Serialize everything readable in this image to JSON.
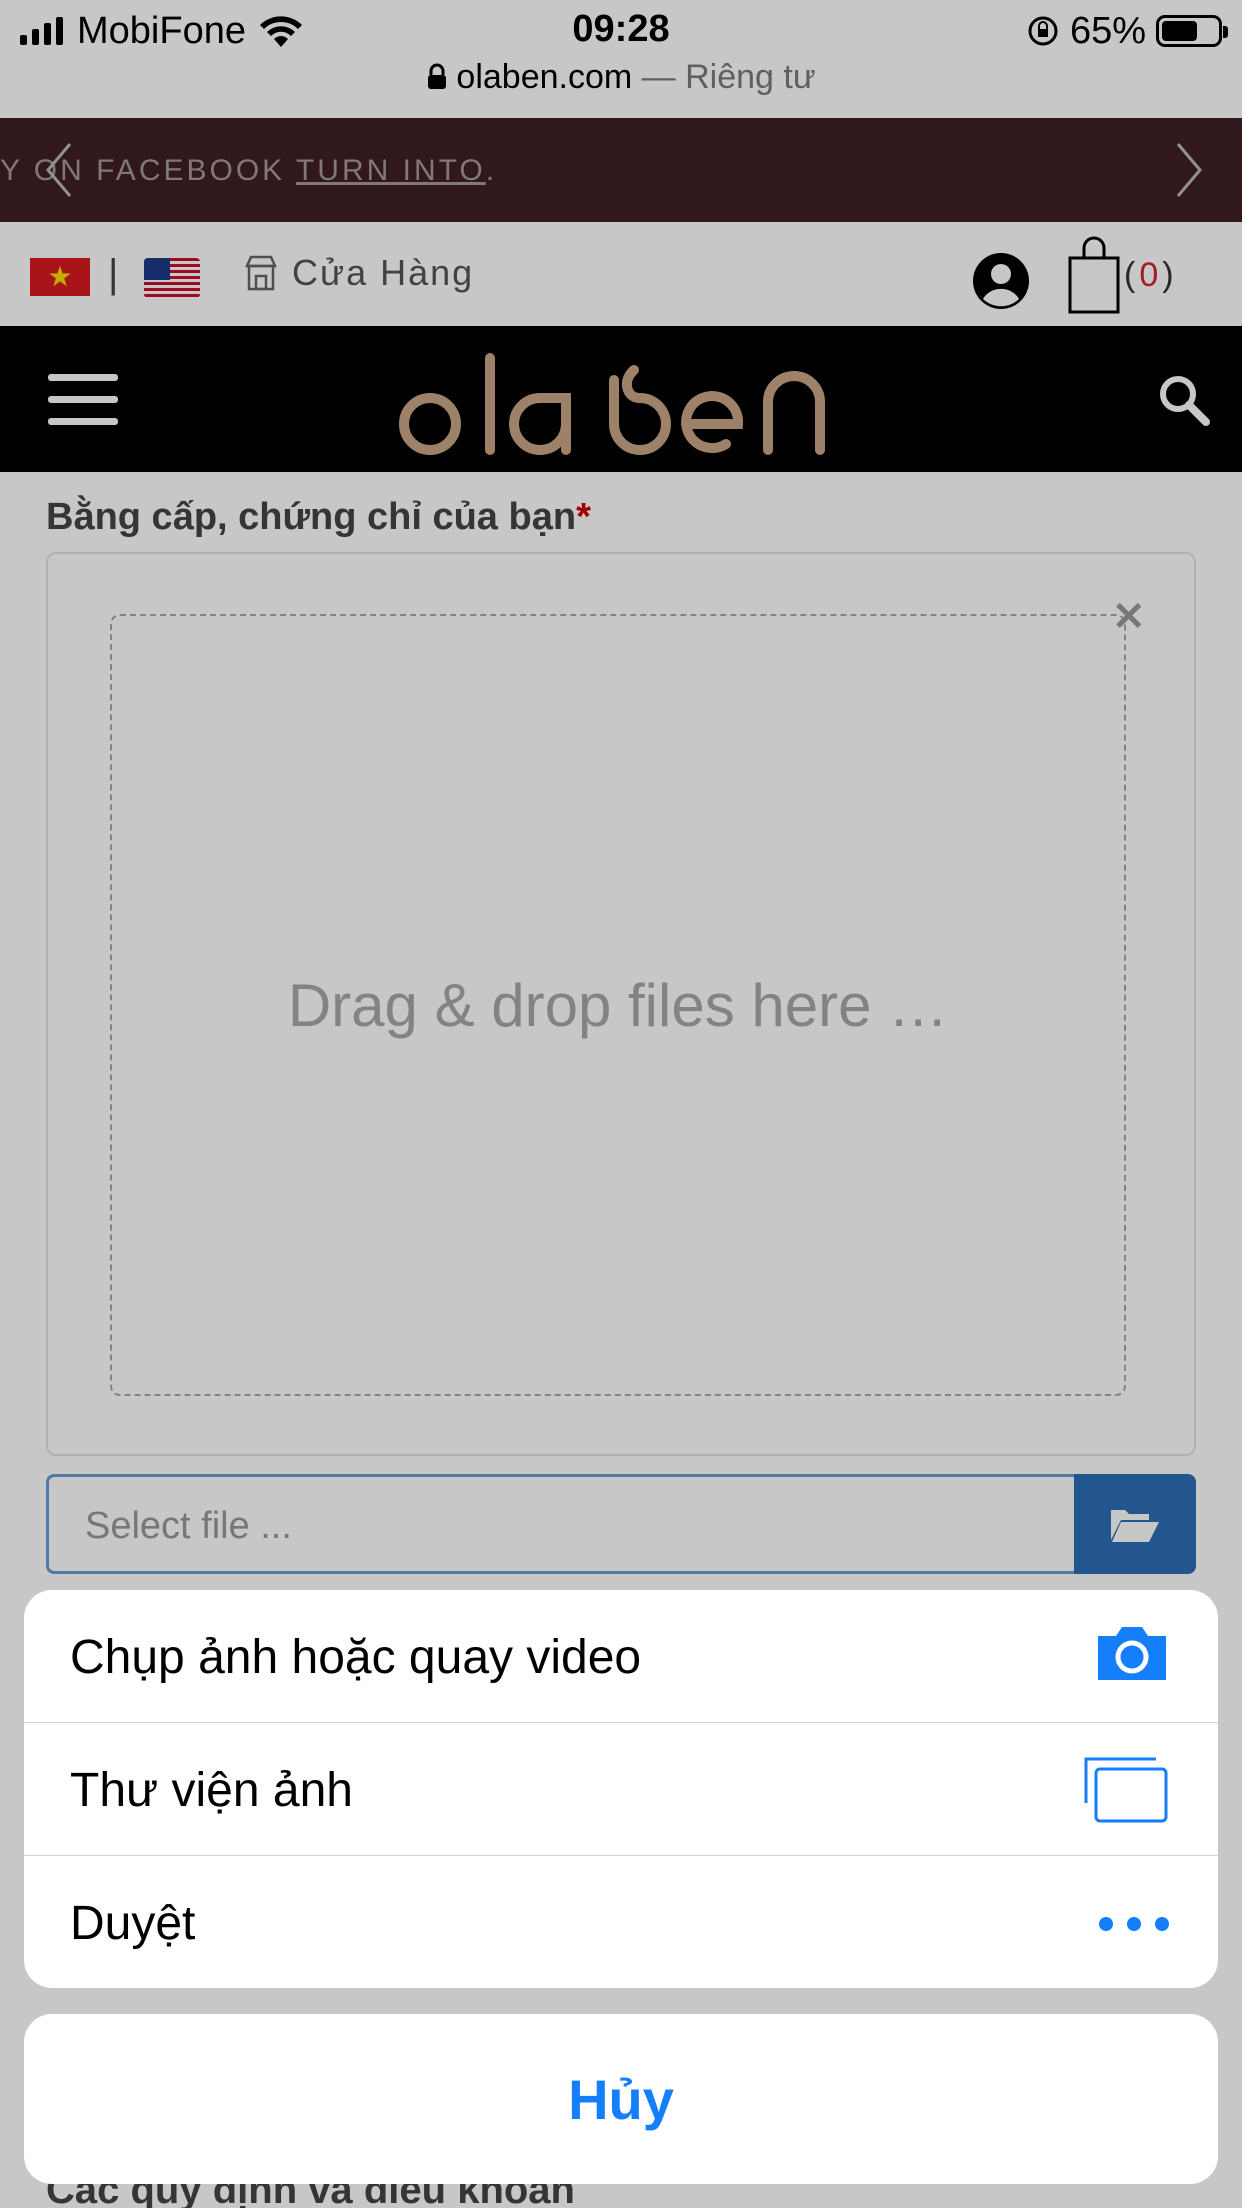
{
  "status_bar": {
    "carrier": "MobiFone",
    "time": "09:28",
    "battery": "65%",
    "battery_level": 0.65
  },
  "browser": {
    "domain": "olaben.com",
    "private_label": "— Riêng tư"
  },
  "promo": {
    "text_before": "Y ON FACEBOOK ",
    "link": "TURN INTO",
    "text_after": "."
  },
  "topbar": {
    "store_label": "Cửa Hàng",
    "cart_open": "(",
    "cart_count": "0",
    "cart_close": ")"
  },
  "header": {
    "logo_text": "olaben"
  },
  "form": {
    "label": "Bằng cấp, chứng chỉ của bạn",
    "required_mark": "*",
    "dropzone_text": "Drag & drop files here …",
    "file_placeholder": "Select file ...",
    "below_label": "Các quy định và điều khoản"
  },
  "action_sheet": {
    "items": [
      {
        "label": "Chụp ảnh hoặc quay video",
        "icon": "camera-icon"
      },
      {
        "label": "Thư viện ảnh",
        "icon": "photo-library-icon"
      },
      {
        "label": "Duyệt",
        "icon": "more-dots-icon"
      }
    ],
    "cancel_label": "Hủy"
  },
  "colors": {
    "ios_blue": "#147efb",
    "promo_bg": "#3f1f26",
    "logo_tan": "#c9a787",
    "required_red": "#cc0000"
  }
}
